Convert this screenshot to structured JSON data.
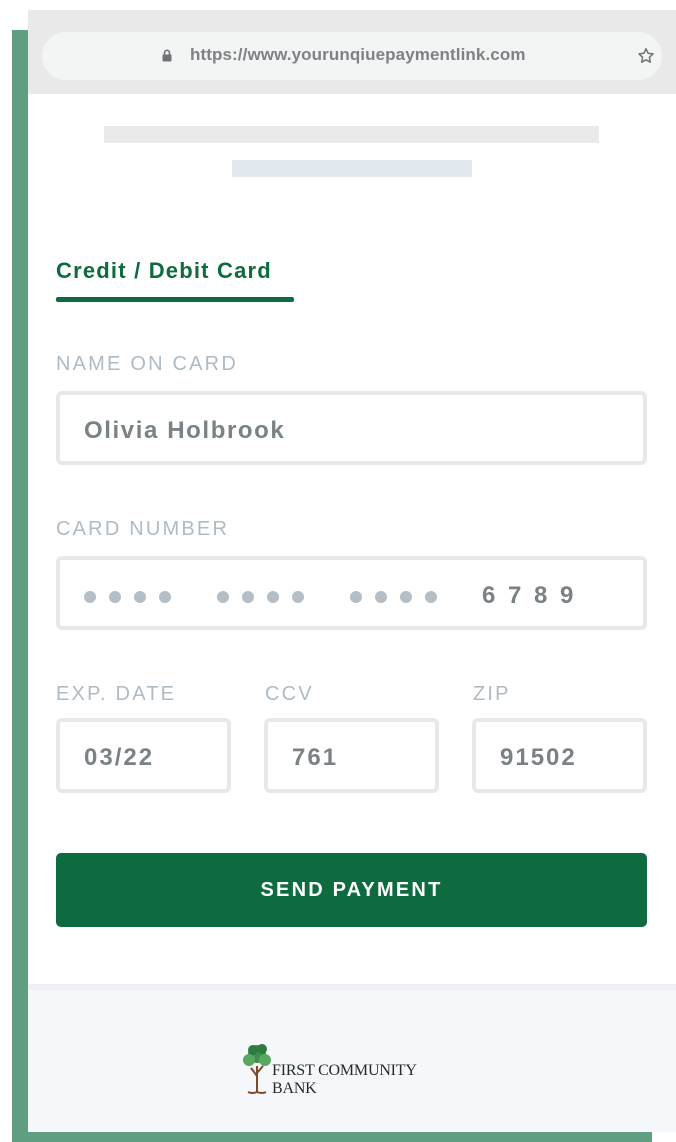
{
  "browser": {
    "url": "https://www.yourunqiuepaymentlink.com",
    "lock_icon": "lock-icon",
    "star_icon": "star-icon"
  },
  "payment": {
    "tab_label": "Credit / Debit Card",
    "name_label": "NAME ON CARD",
    "name_value": "Olivia Holbrook",
    "card_label": "CARD NUMBER",
    "card_last4": "6 7 8 9",
    "exp_label": "EXP. DATE",
    "exp_value": "03/22",
    "ccv_label": "CCV",
    "ccv_value": "761",
    "zip_label": "ZIP",
    "zip_value": "91502",
    "send_label": "SEND PAYMENT"
  },
  "footer": {
    "bank_name": "FIRST COMMUNITY BANK",
    "logo_icon": "tree-icon"
  },
  "colors": {
    "brand_green": "#0e6b3f",
    "accent_green": "#5f9e80",
    "label_gray": "#aebbc4"
  }
}
